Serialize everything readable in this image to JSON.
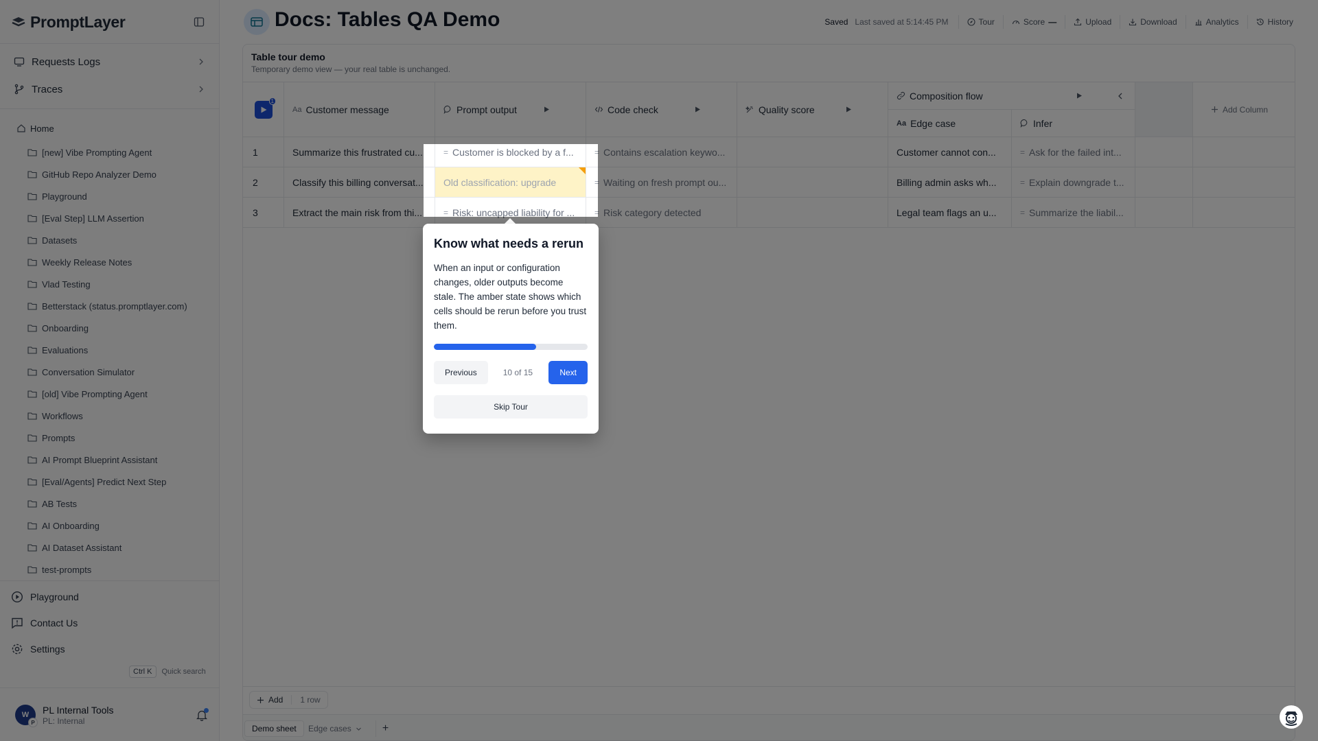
{
  "app": {
    "name": "PromptLayer"
  },
  "sidebar": {
    "top_nav": [
      {
        "label": "Requests Logs"
      },
      {
        "label": "Traces"
      }
    ],
    "home_label": "Home",
    "folders": [
      "[new] Vibe Prompting Agent",
      "GitHub Repo Analyzer Demo",
      "Playground",
      "[Eval Step] LLM Assertion",
      "Datasets",
      "Weekly Release Notes",
      "Vlad Testing",
      "Betterstack (status.promptlayer.com)",
      "Onboarding",
      "Evaluations",
      "Conversation Simulator",
      "[old] Vibe Prompting Agent",
      "Workflows",
      "Prompts",
      "AI Prompt Blueprint Assistant",
      "[Eval/Agents] Predict Next Step",
      "AB Tests",
      "AI Onboarding",
      "AI Dataset Assistant",
      "test-prompts"
    ],
    "bottom_nav": [
      {
        "label": "Playground"
      },
      {
        "label": "Contact Us"
      },
      {
        "label": "Settings"
      }
    ],
    "quick_search": {
      "key": "Ctrl K",
      "label": "Quick search"
    },
    "user": {
      "initial": "W",
      "sub_initial": "P",
      "name": "PL Internal Tools",
      "org": "PL: Internal"
    }
  },
  "header": {
    "title": "Docs: Tables QA Demo",
    "saved": "Saved",
    "last_saved": "Last saved at 5:14:45 PM",
    "actions": [
      {
        "label": "Tour",
        "icon": "compass-icon"
      },
      {
        "label": "Score",
        "icon": "gauge-icon"
      },
      {
        "label": "Upload",
        "icon": "upload-icon"
      },
      {
        "label": "Download",
        "icon": "download-icon"
      },
      {
        "label": "Analytics",
        "icon": "bar-chart-icon"
      },
      {
        "label": "History",
        "icon": "history-icon"
      }
    ],
    "score_value": "—"
  },
  "table": {
    "title": "Table tour demo",
    "subtitle": "Temporary demo view — your real table is unchanged.",
    "run_all_badge": "1",
    "columns": {
      "customer_message": "Customer message",
      "prompt_output": "Prompt output",
      "code_check": "Code check",
      "quality_score": "Quality score",
      "composition_flow": "Composition flow",
      "edge_case": "Edge case",
      "infer": "Infer",
      "add_column": "Add Column"
    },
    "rows": [
      {
        "num": "1",
        "customer_message": "Summarize this frustrated cu...",
        "prompt_output": "Customer is blocked by a f...",
        "code_check": "Contains escalation keywo...",
        "quality_score": "",
        "edge_case": "Customer cannot con...",
        "infer": "Ask for the failed int..."
      },
      {
        "num": "2",
        "customer_message": "Classify this billing conversat...",
        "prompt_output": "Old classification: upgrade",
        "code_check": "Waiting on fresh prompt ou...",
        "quality_score": "",
        "edge_case": "Billing admin asks wh...",
        "infer": "Explain downgrade t..."
      },
      {
        "num": "3",
        "customer_message": "Extract the main risk from thi...",
        "prompt_output": "Risk: uncapped liability for ...",
        "code_check": "Risk category detected",
        "quality_score": "",
        "edge_case": "Legal team flags an u...",
        "infer": "Summarize the liabil..."
      }
    ],
    "add_label": "Add",
    "row_count": "1 row"
  },
  "sheets": {
    "active": "Demo sheet",
    "other": "Edge cases"
  },
  "tour": {
    "title": "Know what needs a rerun",
    "body": "When an input or configuration changes, older outputs become stale. The amber state shows which cells should be rerun before you trust them.",
    "progress": 0.667,
    "previous": "Previous",
    "count": "10 of 15",
    "next": "Next",
    "skip": "Skip Tour"
  },
  "colors": {
    "accent": "#2563eb",
    "stale": "#fef3c7",
    "stale_marker": "#f59e0b"
  }
}
